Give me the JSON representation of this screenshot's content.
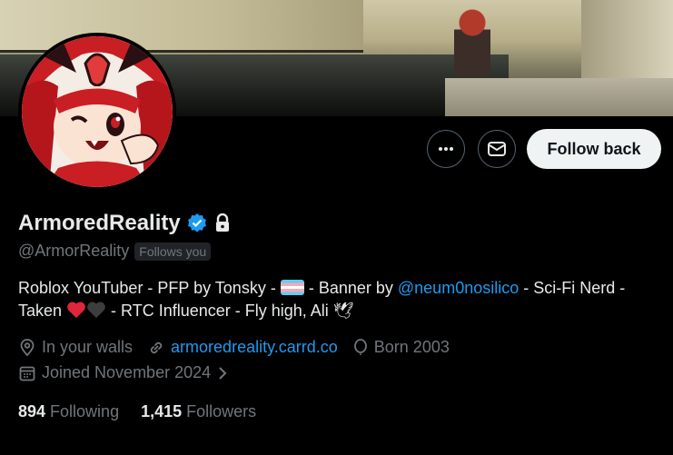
{
  "profile": {
    "display_name": "ArmoredReality",
    "handle": "@ArmorReality",
    "follows_you": "Follows you",
    "verified": true,
    "protected": true
  },
  "actions": {
    "more_icon": "more-icon",
    "message_icon": "mail-icon",
    "follow_label": "Follow back"
  },
  "bio": {
    "part1": "Roblox YouTuber - PFP by Tonsky - ",
    "flag": "transgender-flag-emoji",
    "part2": " - Banner by ",
    "mention": "@neum0nosilico",
    "part3": " - Sci-Fi Nerd -",
    "part4": "Taken ",
    "part5": " - RTC Influencer - Fly high, Ali ",
    "dove": "🕊"
  },
  "meta": {
    "location": "In your walls",
    "website": "armoredreality.carrd.co",
    "born": "Born 2003",
    "joined": "Joined November 2024"
  },
  "stats": {
    "following_count": "894",
    "following_label": "Following",
    "followers_count": "1,415",
    "followers_label": "Followers"
  },
  "colors": {
    "accent": "#1d9bf0",
    "secondary_text": "#71767b",
    "primary_text": "#e7e9ea",
    "verified_badge": "#1d9bf0"
  }
}
